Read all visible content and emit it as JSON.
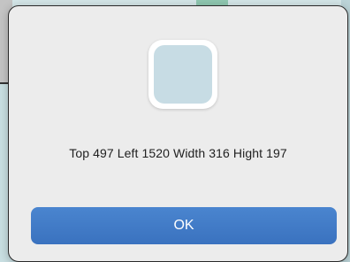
{
  "dialog": {
    "icon": "app-icon",
    "message": "Top 497 Left 1520 Width 316 Hight 197",
    "ok_label": "OK"
  },
  "colors": {
    "button": "#3f79c6",
    "dialog_background": "#ececec",
    "icon_fill": "#c7dce4"
  }
}
